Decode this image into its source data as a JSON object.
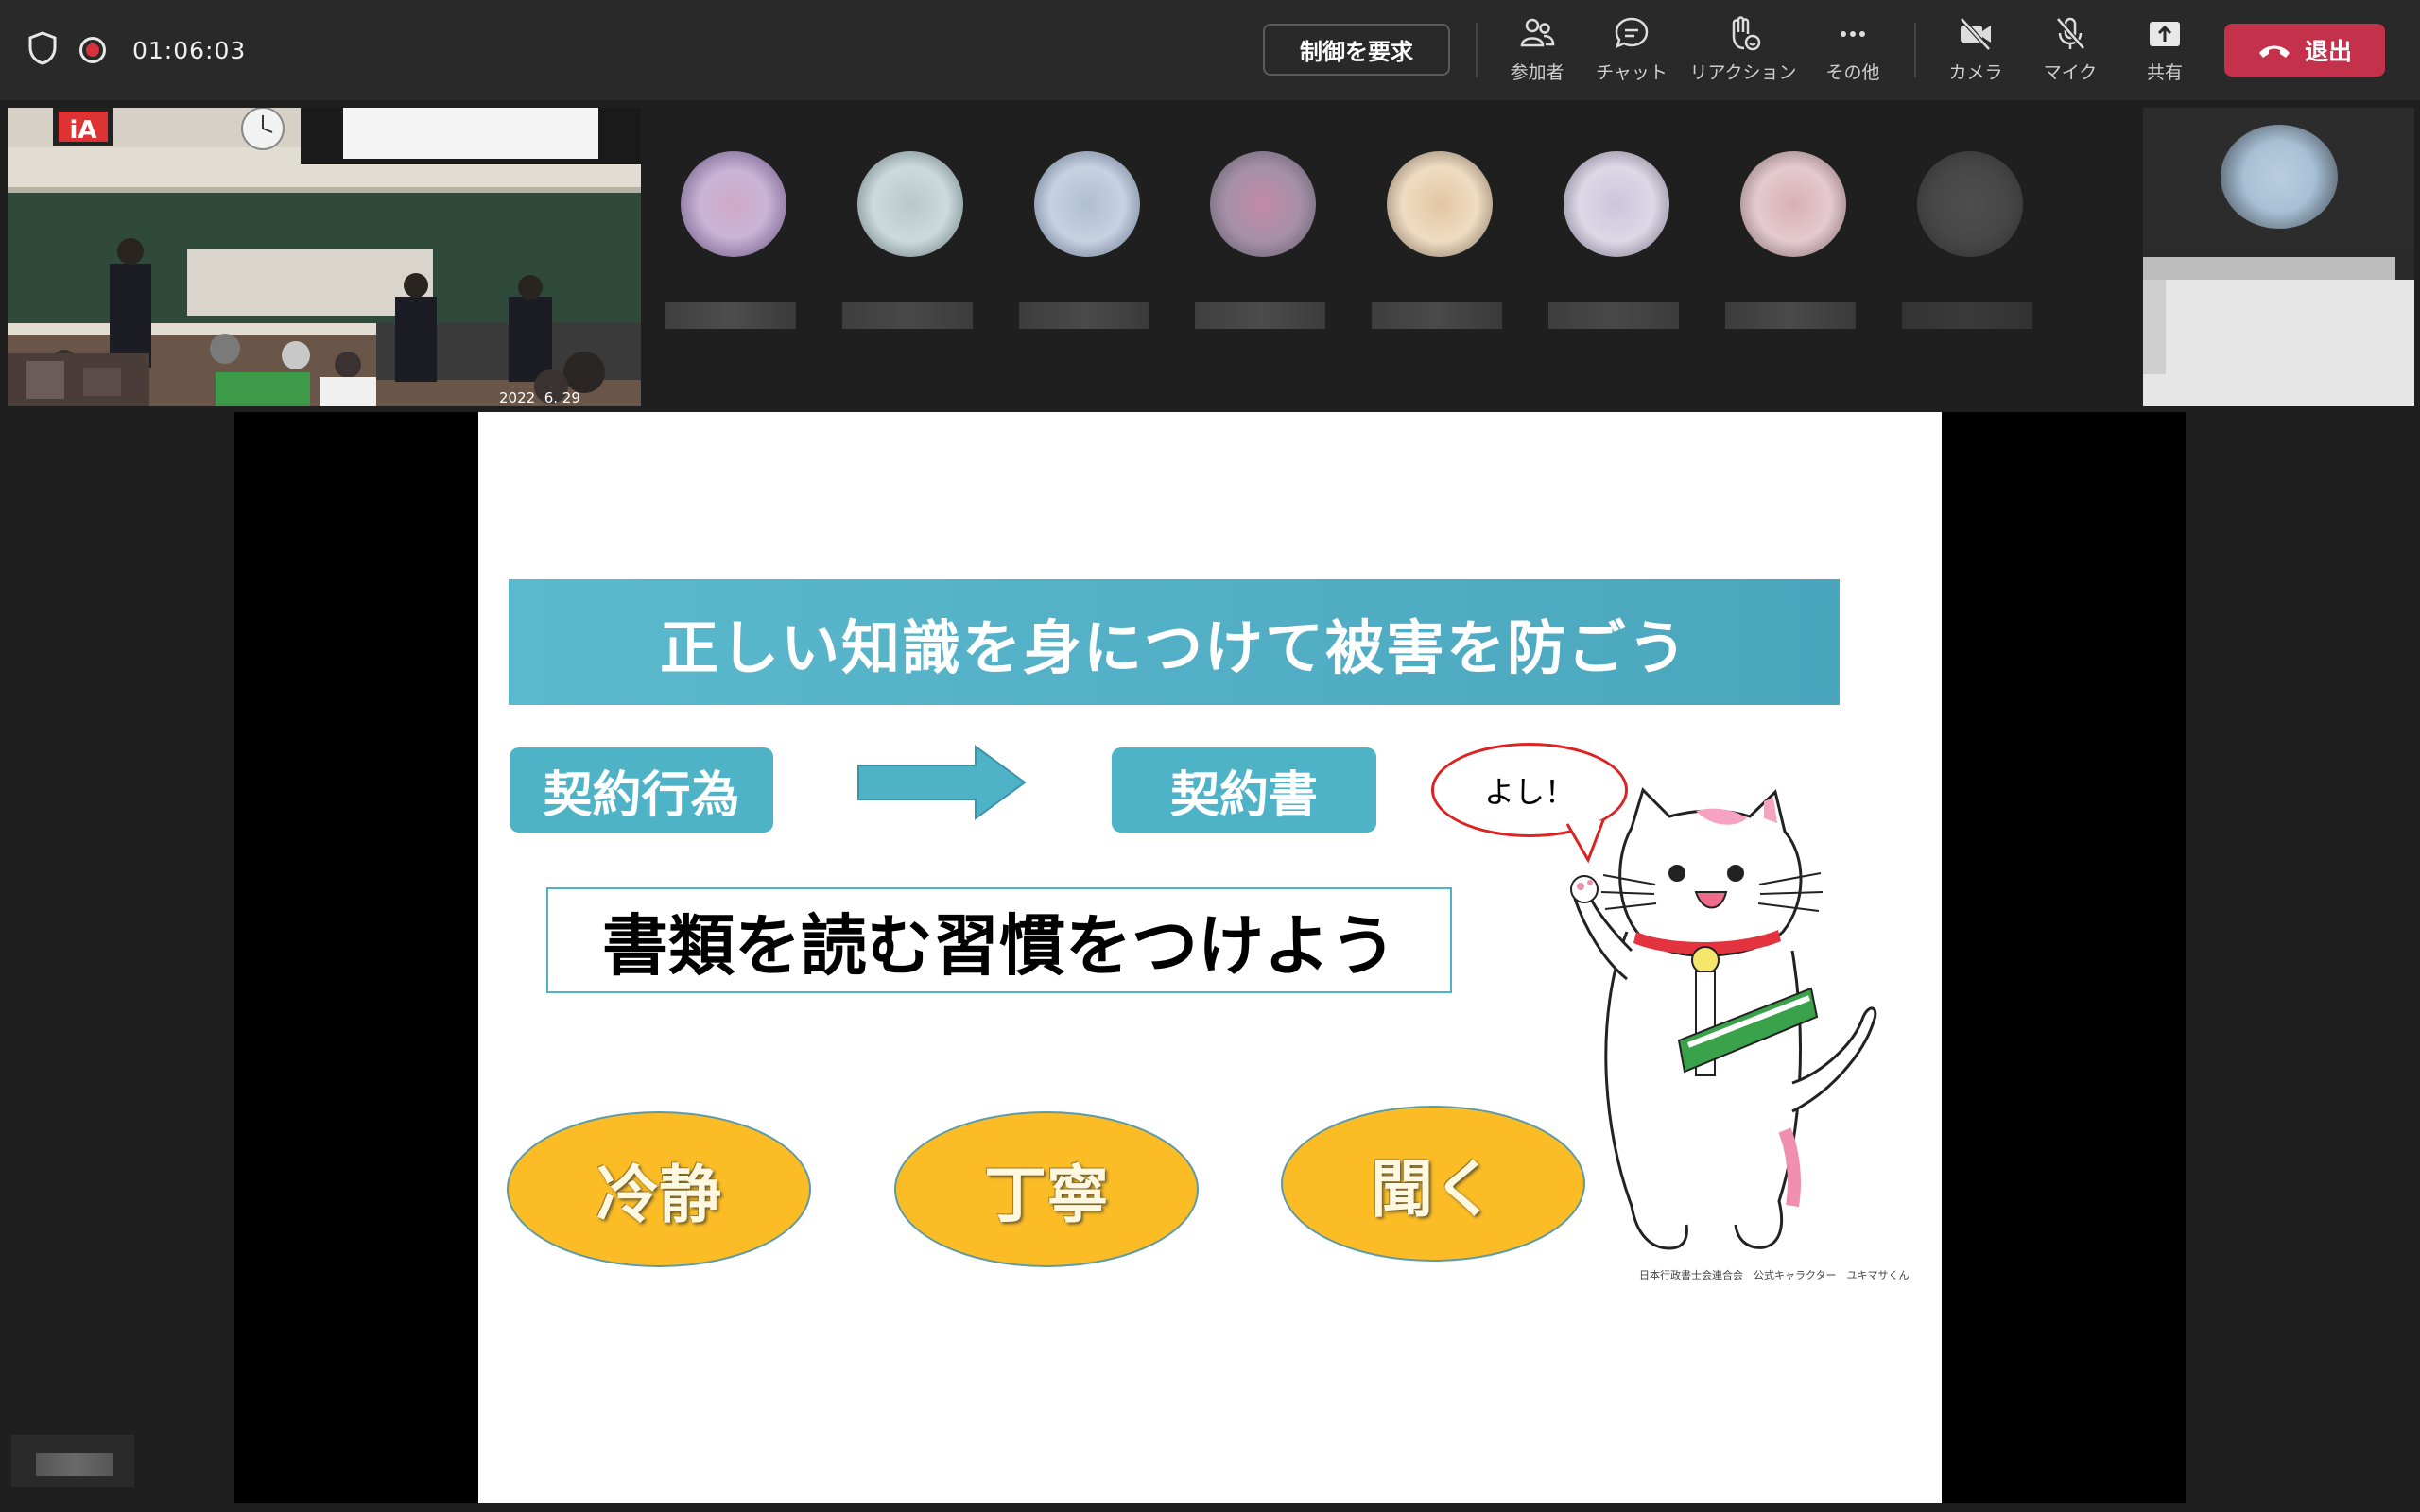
{
  "meeting": {
    "timer": "01:06:03",
    "request_control_label": "制御を要求",
    "toolbar": [
      {
        "id": "participants",
        "label": "参加者",
        "icon": "participants-icon"
      },
      {
        "id": "chat",
        "label": "チャット",
        "icon": "chat-icon"
      },
      {
        "id": "reactions",
        "label": "リアクション",
        "icon": "raise-hand-icon"
      },
      {
        "id": "more",
        "label": "その他",
        "icon": "more-icon"
      },
      {
        "id": "camera",
        "label": "カメラ",
        "icon": "camera-off-icon"
      },
      {
        "id": "mic",
        "label": "マイク",
        "icon": "mic-off-icon"
      },
      {
        "id": "share",
        "label": "共有",
        "icon": "share-icon"
      }
    ],
    "leave_label": "退出",
    "leave_color": "#c4314b"
  },
  "gallery": {
    "room_camera": {
      "sign": "iA",
      "timestamp": "2022  6. 29"
    },
    "participant_count_visible": 8
  },
  "slide": {
    "banner": "正しい知識を身につけて被害を防ごう",
    "left_box": "契約行為",
    "right_box": "契約書",
    "habit_text": "書類を読む習慣をつけよう",
    "ovals": [
      "冷静",
      "丁寧",
      "聞く"
    ],
    "speech_bubble": "よし！",
    "caption": "日本行政書士会連合会　公式キャラクター　ユキマサくん",
    "colors": {
      "banner": "#4fb3c8",
      "oval": "#fbbc26"
    }
  }
}
